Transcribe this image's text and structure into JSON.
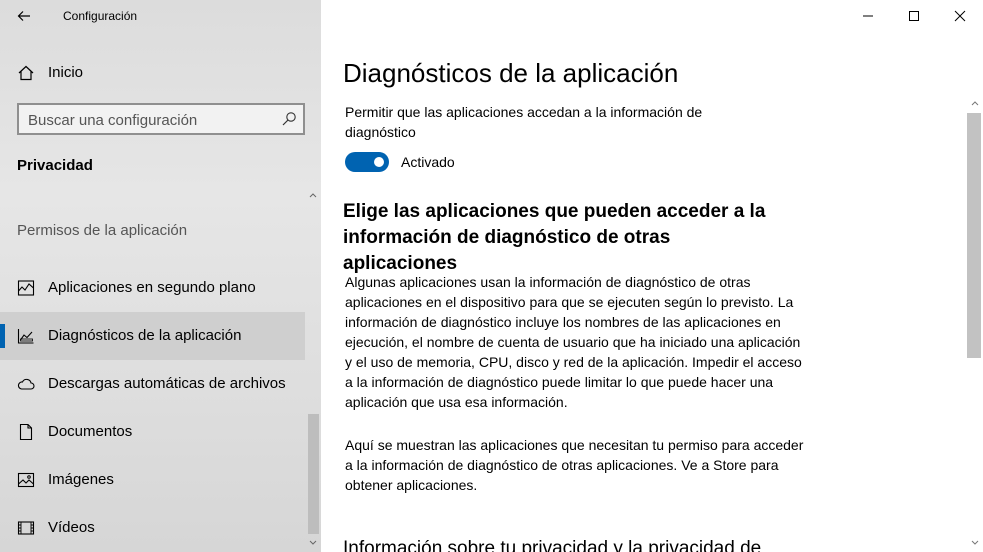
{
  "window": {
    "title": "Configuración",
    "controls": {
      "minimize_icon": "minimize-icon",
      "maximize_icon": "maximize-icon",
      "close_icon": "close-icon"
    }
  },
  "sidebar": {
    "home_label": "Inicio",
    "search_placeholder": "Buscar una configuración",
    "section_title": "Privacidad",
    "group_title": "Permisos de la aplicación",
    "items": [
      {
        "label": "Aplicaciones en segundo plano",
        "icon": "background-apps-icon",
        "selected": false
      },
      {
        "label": "Diagnósticos de la aplicación",
        "icon": "diagnostics-icon",
        "selected": true
      },
      {
        "label": "Descargas automáticas de archivos",
        "icon": "cloud-icon",
        "selected": false
      },
      {
        "label": "Documentos",
        "icon": "document-icon",
        "selected": false
      },
      {
        "label": "Imágenes",
        "icon": "image-icon",
        "selected": false
      },
      {
        "label": "Vídeos",
        "icon": "video-icon",
        "selected": false
      }
    ]
  },
  "main": {
    "title": "Diagnósticos de la aplicación",
    "toggle_description": "Permitir que las aplicaciones accedan a la información de diagnóstico",
    "toggle_state": "Activado",
    "toggle_on": true,
    "subheading": "Elige las aplicaciones que pueden acceder a la información de diagnóstico de otras aplicaciones",
    "paragraph1": "Algunas aplicaciones usan la información de diagnóstico de otras aplicaciones en el dispositivo para que se ejecuten según lo previsto. La información de diagnóstico incluye los nombres de las aplicaciones en ejecución, el nombre de cuenta de usuario que ha iniciado una aplicación y el uso de memoria, CPU, disco y red de la aplicación. Impedir el acceso a la información de diagnóstico puede limitar lo que puede hacer una aplicación que usa esa información.",
    "paragraph2": "Aquí se muestran las aplicaciones que necesitan tu permiso para acceder a la información de diagnóstico de otras aplicaciones. Ve a Store para obtener aplicaciones.",
    "next_heading_partial": "Información sobre tu privacidad y la privacidad de"
  },
  "colors": {
    "accent": "#0063b1",
    "sidebar_bg": "#e2e2e2",
    "selected_bg": "#cfcfcf"
  }
}
